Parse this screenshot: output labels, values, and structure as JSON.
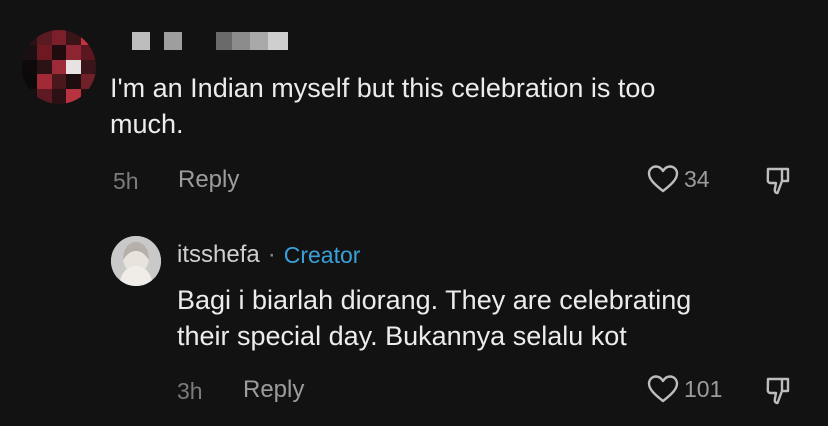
{
  "comments": [
    {
      "text": "I'm an Indian myself but this celebration is too much.",
      "text_line1": "I'm an Indian myself but this celebration is too",
      "text_line2": "much.",
      "time": "5h",
      "reply_label": "Reply",
      "likes": "34",
      "avatar_icon": "pixelated-avatar",
      "username_censored": true
    },
    {
      "username": "itsshefa",
      "separator": "·",
      "badge": "Creator",
      "text_line1": "Bagi i biarlah diorang. They are celebrating",
      "text_line2": "their special day. Bukannya selalu kot",
      "time": "3h",
      "reply_label": "Reply",
      "likes": "101",
      "avatar_icon": "profile-avatar"
    }
  ],
  "icons": {
    "like": "heart-outline-icon",
    "dislike": "thumbs-down-outline-icon"
  },
  "colors": {
    "background": "#121212",
    "creator_badge": "#3aa0d8"
  }
}
